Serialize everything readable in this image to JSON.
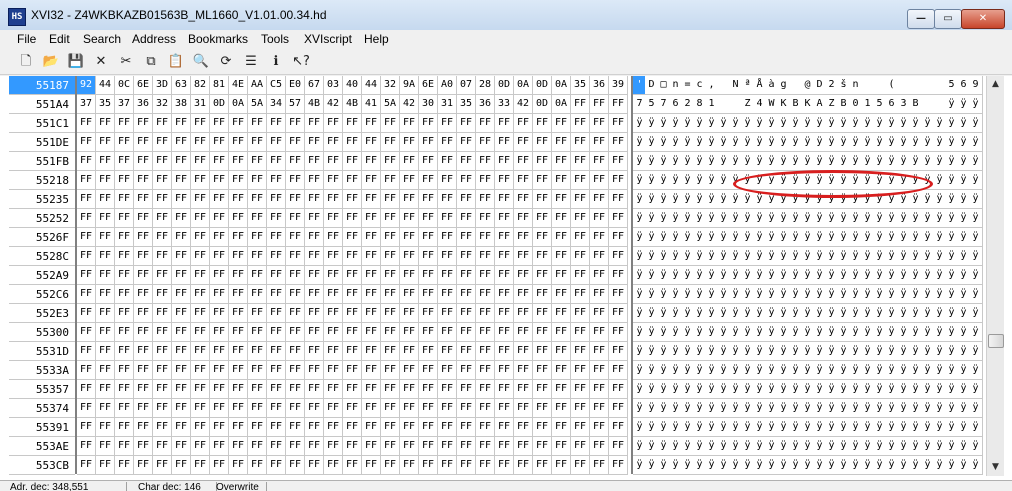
{
  "window": {
    "title": "XVI32 - Z4WKBKAZB01563B_ML1660_V1.01.00.34.hd",
    "app_icon_text": "HS",
    "min_glyph": "—",
    "max_glyph": "▭",
    "close_glyph": "✕"
  },
  "menu": [
    "File",
    "Edit",
    "Search",
    "Address",
    "Bookmarks",
    "Tools",
    "XVIscript",
    "Help"
  ],
  "toolbar": {
    "icons": [
      {
        "name": "new-file-icon",
        "glyph": "🗋"
      },
      {
        "name": "open-folder-icon",
        "glyph": "📂"
      },
      {
        "name": "save-icon",
        "glyph": "💾"
      },
      {
        "name": "close-x-icon",
        "glyph": "✕"
      },
      {
        "name": "cut-icon",
        "glyph": "✂"
      },
      {
        "name": "copy-icon",
        "glyph": "⧉"
      },
      {
        "name": "paste-icon",
        "glyph": "📋"
      },
      {
        "name": "find-icon",
        "glyph": "🔍"
      },
      {
        "name": "replace-icon",
        "glyph": "⟳"
      },
      {
        "name": "properties-icon",
        "glyph": "☰"
      },
      {
        "name": "script-icon",
        "glyph": "ℹ"
      },
      {
        "name": "help-pointer-icon",
        "glyph": "↖?"
      }
    ]
  },
  "editor": {
    "rows": [
      {
        "address": "55187",
        "bytes": [
          "92",
          "44",
          "0C",
          "6E",
          "3D",
          "63",
          "82",
          "81",
          "4E",
          "AA",
          "C5",
          "E0",
          "67",
          "03",
          "40",
          "44",
          "32",
          "9A",
          "6E",
          "A0",
          "07",
          "28",
          "0D",
          "0A",
          "0D",
          "0A",
          "35",
          "36",
          "39"
        ],
        "chars": [
          "'",
          "D",
          "□",
          "n",
          "=",
          "c",
          ",",
          "",
          "N",
          "ª",
          "Å",
          "à",
          "g",
          "",
          "@",
          "D",
          "2",
          "š",
          "n",
          " ",
          "",
          "(",
          "",
          "",
          "",
          "",
          "5",
          "6",
          "9"
        ],
        "selected": true
      },
      {
        "address": "551A4",
        "bytes": [
          "37",
          "35",
          "37",
          "36",
          "32",
          "38",
          "31",
          "0D",
          "0A",
          "5A",
          "34",
          "57",
          "4B",
          "42",
          "4B",
          "41",
          "5A",
          "42",
          "30",
          "31",
          "35",
          "36",
          "33",
          "42",
          "0D",
          "0A",
          "FF",
          "FF",
          "FF"
        ],
        "chars": [
          "7",
          "5",
          "7",
          "6",
          "2",
          "8",
          "1",
          "",
          "",
          "Z",
          "4",
          "W",
          "K",
          "B",
          "K",
          "A",
          "Z",
          "B",
          "0",
          "1",
          "5",
          "6",
          "3",
          "B",
          "",
          "",
          "ÿ",
          "ÿ",
          "ÿ"
        ]
      },
      {
        "address": "551C1",
        "fill": true
      },
      {
        "address": "551DE",
        "fill": true
      },
      {
        "address": "551FB",
        "fill": true
      },
      {
        "address": "55218",
        "fill": true
      },
      {
        "address": "55235",
        "fill": true
      },
      {
        "address": "55252",
        "fill": true
      },
      {
        "address": "5526F",
        "fill": true
      },
      {
        "address": "5528C",
        "fill": true
      },
      {
        "address": "552A9",
        "fill": true
      },
      {
        "address": "552C6",
        "fill": true
      },
      {
        "address": "552E3",
        "fill": true
      },
      {
        "address": "55300",
        "fill": true
      },
      {
        "address": "5531D",
        "fill": true
      },
      {
        "address": "5533A",
        "fill": true
      },
      {
        "address": "55357",
        "fill": true
      },
      {
        "address": "55374",
        "fill": true
      },
      {
        "address": "55391",
        "fill": true
      },
      {
        "address": "553AE",
        "fill": true
      },
      {
        "address": "553CB",
        "fill": true
      }
    ],
    "fill_byte": "FF",
    "fill_char": "ÿ",
    "bytes_per_row": 29
  },
  "scrollbar": {
    "up_glyph": "▲",
    "down_glyph": "▼"
  },
  "status": {
    "adr": "Adr. dec: 348,551",
    "char": "Char dec: 146",
    "mode": "Overwrite"
  },
  "colors": {
    "selection": "#3399ff",
    "annotation": "#d81e1e"
  }
}
